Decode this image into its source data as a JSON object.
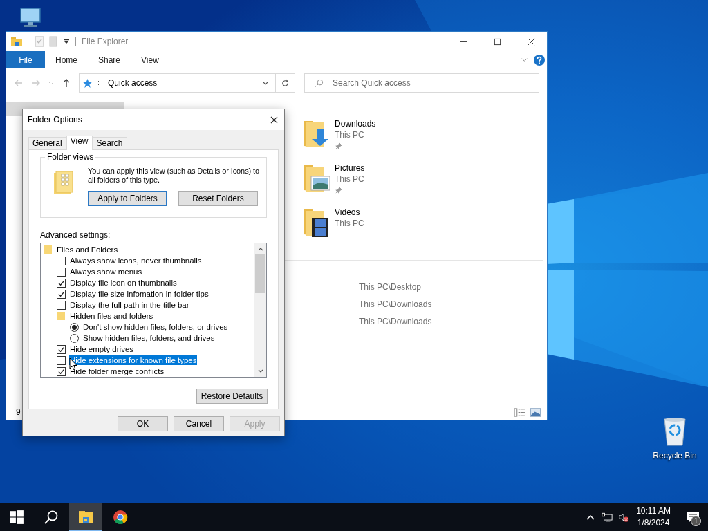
{
  "desktop": {
    "icons": [
      {
        "label": "Recycle Bin"
      }
    ]
  },
  "explorer": {
    "title": "File Explorer",
    "ribbon_tabs": [
      {
        "label": "File",
        "kind": "file"
      },
      {
        "label": "Home",
        "kind": "tab"
      },
      {
        "label": "Share",
        "kind": "tab"
      },
      {
        "label": "View",
        "kind": "tab"
      }
    ],
    "address": {
      "path": "Quick access"
    },
    "search": {
      "placeholder": "Search Quick access"
    },
    "folders": [
      {
        "name": "Downloads",
        "location": "This PC",
        "kind": "downloads",
        "pinned": true
      },
      {
        "name": "Pictures",
        "location": "This PC",
        "kind": "pictures",
        "pinned": true
      },
      {
        "name": "Videos",
        "location": "This PC",
        "kind": "videos",
        "pinned": false
      }
    ],
    "recent_files": [
      {
        "path": "This PC\\Desktop"
      },
      {
        "path": "This PC\\Downloads"
      },
      {
        "path": "This PC\\Downloads"
      }
    ],
    "status_text": "9"
  },
  "folder_options": {
    "title": "Folder Options",
    "tabs": [
      {
        "label": "General",
        "selected": false
      },
      {
        "label": "View",
        "selected": true
      },
      {
        "label": "Search",
        "selected": false
      }
    ],
    "folder_views": {
      "legend": "Folder views",
      "text": "You can apply this view (such as Details or Icons) to all folders of this type.",
      "buttons": [
        {
          "label": "Apply to Folders",
          "default": true
        },
        {
          "label": "Reset Folders",
          "default": false
        }
      ]
    },
    "advanced_settings": {
      "label": "Advanced settings:",
      "items": [
        {
          "kind": "folder",
          "label": "Files and Folders",
          "selected": false,
          "children": [
            {
              "kind": "checkbox",
              "label": "Always show icons, never thumbnails",
              "checked": false,
              "selected": false
            },
            {
              "kind": "checkbox",
              "label": "Always show menus",
              "checked": false,
              "selected": false
            },
            {
              "kind": "checkbox",
              "label": "Display file icon on thumbnails",
              "checked": true,
              "selected": false
            },
            {
              "kind": "checkbox",
              "label": "Display file size infomation in folder tips",
              "checked": true,
              "selected": false
            },
            {
              "kind": "checkbox",
              "label": "Display the full path in the title bar",
              "checked": false,
              "selected": false
            },
            {
              "kind": "folder",
              "label": "Hidden files and folders",
              "selected": false,
              "children": [
                {
                  "kind": "radio",
                  "label": "Don't show hidden files, folders, or drives",
                  "checked": true,
                  "selected": false
                },
                {
                  "kind": "radio",
                  "label": "Show hidden files, folders, and drives",
                  "checked": false,
                  "selected": false
                }
              ]
            },
            {
              "kind": "checkbox",
              "label": "Hide empty drives",
              "checked": true,
              "selected": false
            },
            {
              "kind": "checkbox",
              "label": "Hide extensions for known file types",
              "checked": false,
              "selected": true
            },
            {
              "kind": "checkbox",
              "label": "Hide folder merge conflicts",
              "checked": true,
              "selected": false
            }
          ]
        }
      ]
    },
    "restore_button": "Restore Defaults",
    "buttons": [
      {
        "label": "OK",
        "disabled": false
      },
      {
        "label": "Cancel",
        "disabled": false
      },
      {
        "label": "Apply",
        "disabled": true
      }
    ]
  },
  "taskbar": {
    "apps": [
      {
        "kind": "start",
        "active": false
      },
      {
        "kind": "search",
        "active": false
      },
      {
        "kind": "explorer",
        "active": true
      },
      {
        "kind": "chrome",
        "active": false
      }
    ],
    "time": "10:11 AM",
    "date": "1/8/2024",
    "notification_count": "1"
  }
}
